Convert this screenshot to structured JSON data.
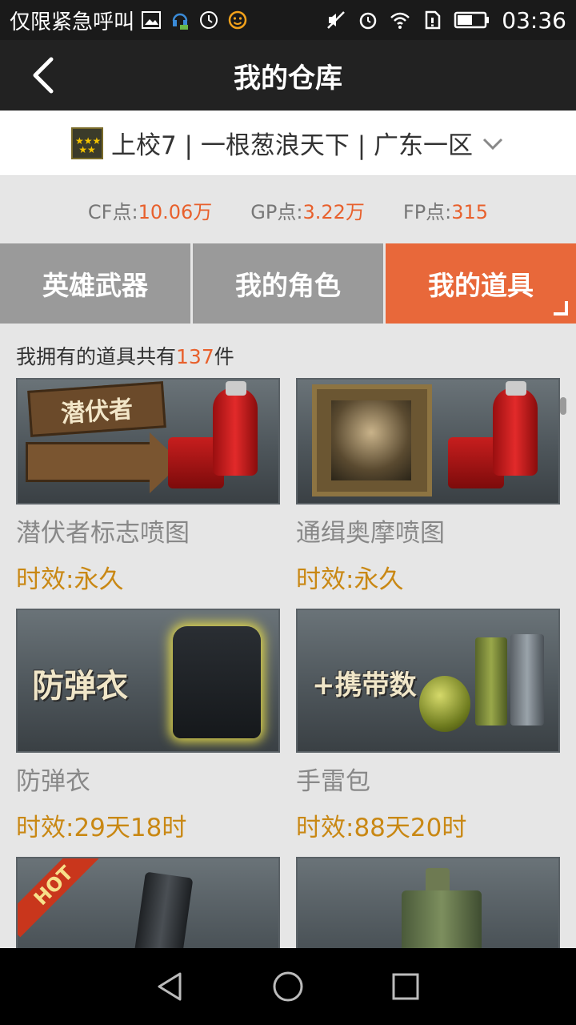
{
  "status_bar": {
    "carrier_text": "仅限紧急呼叫",
    "time": "03:36",
    "icons_left": [
      "image-icon",
      "headset-icon",
      "sync-icon",
      "smiley-icon"
    ],
    "icons_right": [
      "mute-icon",
      "alarm-icon",
      "wifi-icon",
      "sim-icon",
      "battery-icon"
    ]
  },
  "header": {
    "title": "我的仓库"
  },
  "account": {
    "text": "上校7 | 一根葱浪天下 | 广东一区"
  },
  "points": {
    "cf_label": "CF点:",
    "cf_value": "10.06万",
    "gp_label": "GP点:",
    "gp_value": "3.22万",
    "fp_label": "FP点:",
    "fp_value": "315"
  },
  "tabs": [
    {
      "label": "英雄武器",
      "active": false
    },
    {
      "label": "我的角色",
      "active": false
    },
    {
      "label": "我的道具",
      "active": true
    }
  ],
  "summary": {
    "prefix": "我拥有的道具共有",
    "count": "137",
    "suffix": "件"
  },
  "items": [
    {
      "name": "潜伏者标志喷图",
      "duration": "时效:永久",
      "thumb_text": "潜伏者"
    },
    {
      "name": "通缉奥摩喷图",
      "duration": "时效:永久",
      "thumb_text": ""
    },
    {
      "name": "防弹衣",
      "duration": "时效:29天18时",
      "thumb_text": "防弹衣"
    },
    {
      "name": "手雷包",
      "duration": "时效:88天20时",
      "thumb_text": "+携带数"
    },
    {
      "name": "",
      "duration": "",
      "thumb_text": "HOT"
    },
    {
      "name": "",
      "duration": "",
      "thumb_text": ""
    }
  ],
  "colors": {
    "accent": "#e8683a",
    "highlight": "#e8602c",
    "duration": "#c98814",
    "tab_inactive": "#9a9a9a"
  }
}
